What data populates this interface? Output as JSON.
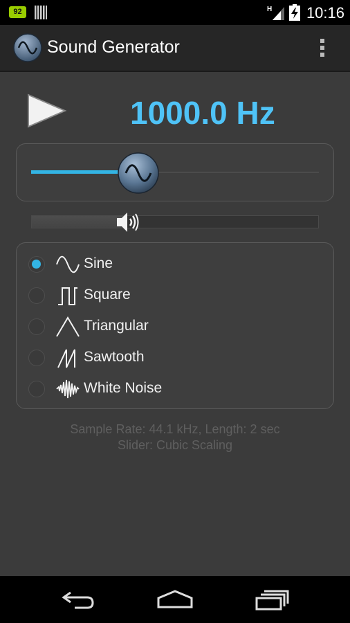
{
  "status_bar": {
    "battery_level": "92",
    "network_type": "H",
    "time": "10:16"
  },
  "action_bar": {
    "title": "Sound Generator",
    "icon": "sine-wave-app-icon",
    "menu_icon": "overflow-menu-icon"
  },
  "player": {
    "play_icon": "play-icon",
    "frequency": "1000.0 Hz"
  },
  "frequency_slider": {
    "level": 0.34,
    "thumb_icon": "sine-wave-icon"
  },
  "volume_slider": {
    "level": 0.33,
    "icon": "speaker-icon"
  },
  "waveforms": [
    {
      "label": "Sine",
      "icon": "sine-wave-icon",
      "selected": true
    },
    {
      "label": "Square",
      "icon": "square-wave-icon",
      "selected": false
    },
    {
      "label": "Triangular",
      "icon": "triangle-wave-icon",
      "selected": false
    },
    {
      "label": "Sawtooth",
      "icon": "sawtooth-wave-icon",
      "selected": false
    },
    {
      "label": "White Noise",
      "icon": "white-noise-icon",
      "selected": false
    }
  ],
  "info": {
    "sample_rate_line": "Sample Rate: 44.1 kHz, Length: 2 sec",
    "slider_line": "Slider: Cubic Scaling"
  },
  "nav_bar": {
    "back_icon": "back-icon",
    "home_icon": "home-icon",
    "recents_icon": "recent-apps-icon"
  },
  "colors": {
    "accent": "#33b5e5",
    "frequency_text": "#4fc3f7",
    "background": "#3b3b3b"
  }
}
